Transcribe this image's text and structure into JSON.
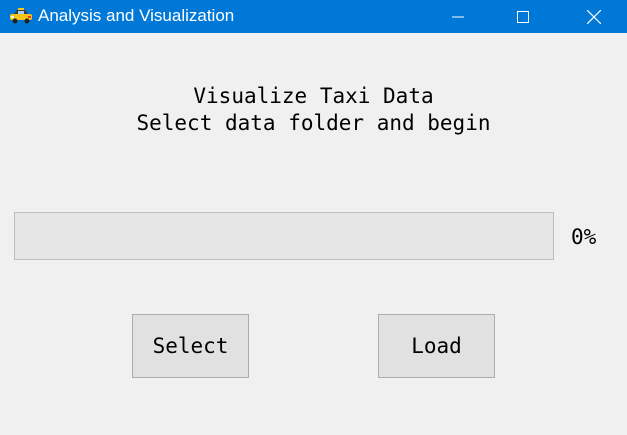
{
  "window": {
    "title": "Analysis and Visualization",
    "icon": "taxi-icon",
    "controls": [
      "minimize-icon",
      "maximize-icon",
      "close-icon"
    ],
    "titlebar_color": "#0078d7"
  },
  "main": {
    "heading_line1": "Visualize Taxi Data",
    "heading_line2": "Select data folder and begin"
  },
  "progress": {
    "value_percent": 0,
    "label": "0%"
  },
  "buttons": {
    "select_label": "Select",
    "load_label": "Load"
  }
}
